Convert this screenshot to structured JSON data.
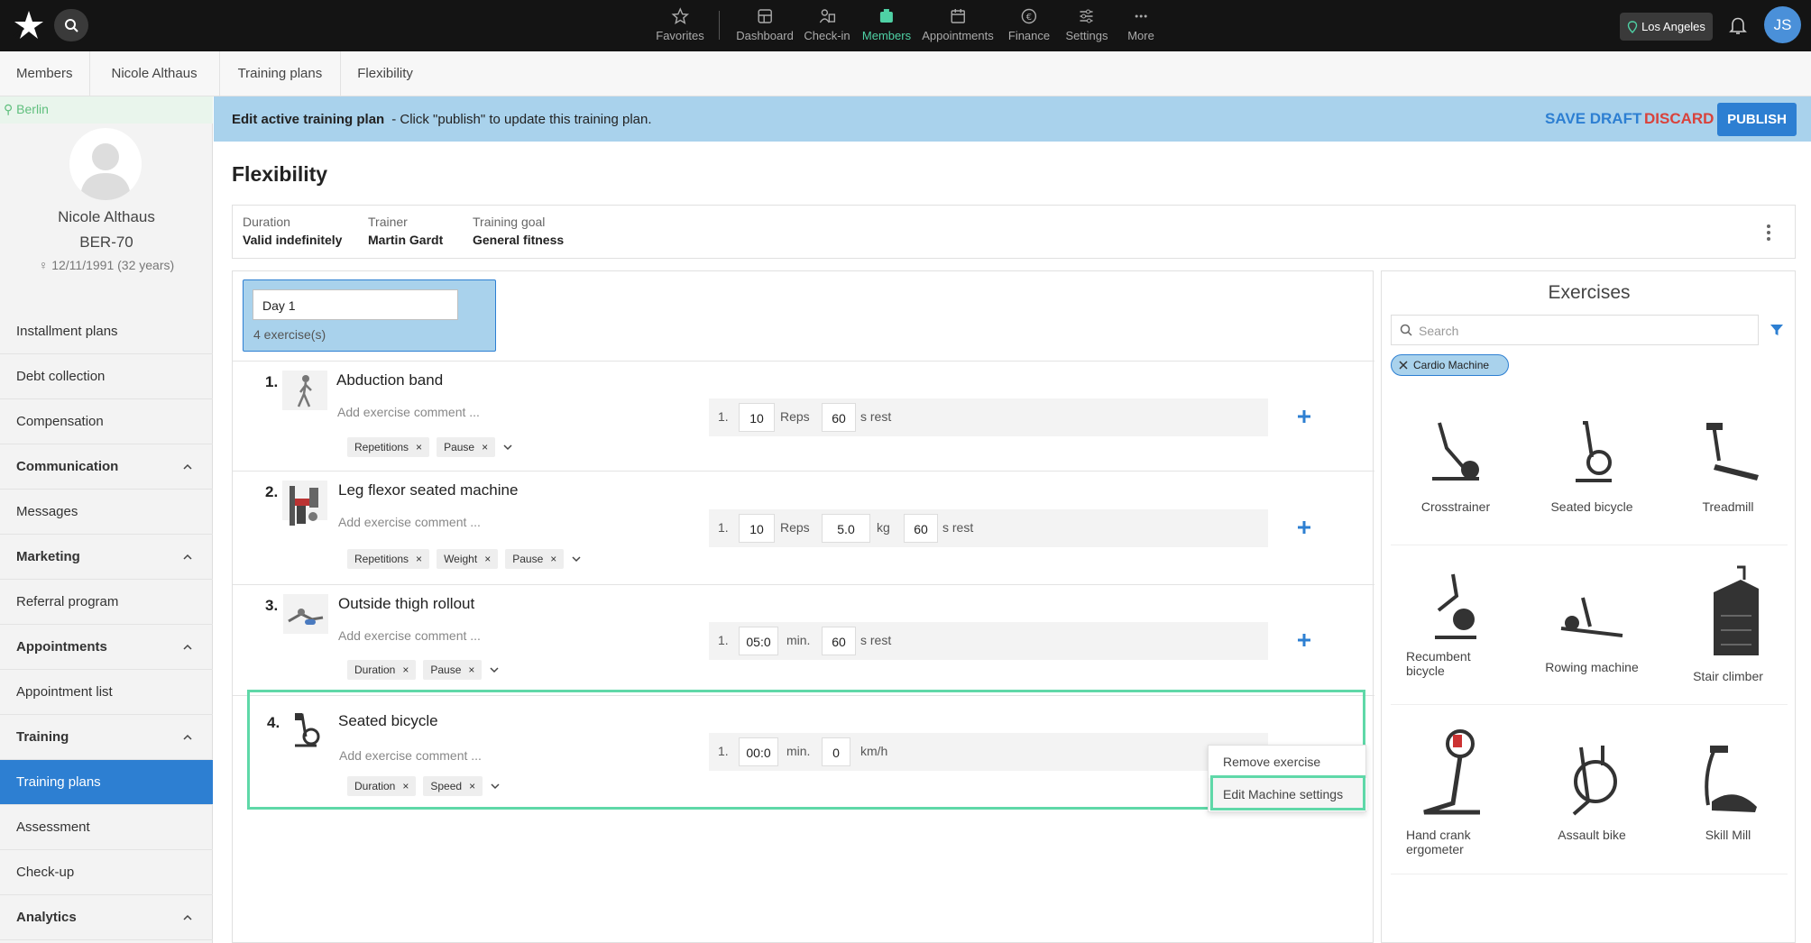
{
  "nav": {
    "items": [
      {
        "label": "Favorites",
        "icon": "star-icon"
      },
      {
        "label": "Dashboard",
        "icon": "dashboard-icon"
      },
      {
        "label": "Check-in",
        "icon": "check-in-icon"
      },
      {
        "label": "Members",
        "icon": "members-icon",
        "active": true
      },
      {
        "label": "Appointments",
        "icon": "calendar-icon"
      },
      {
        "label": "Finance",
        "icon": "euro-icon"
      },
      {
        "label": "Settings",
        "icon": "sliders-icon"
      },
      {
        "label": "More",
        "icon": "more-icon"
      }
    ],
    "location": "Los Angeles",
    "user_initials": "JS",
    "accent": "#4fd1a5"
  },
  "breadcrumb": [
    "Members",
    "Nicole Althaus",
    "Training plans",
    "Flexibility"
  ],
  "member": {
    "location": "Berlin",
    "name": "Nicole Althaus",
    "id": "BER-70",
    "dob": "12/11/1991 (32 years)"
  },
  "sidebar": {
    "items": [
      {
        "label": "Installment plans"
      },
      {
        "label": "Debt collection"
      },
      {
        "label": "Compensation"
      },
      {
        "label": "Communication",
        "header": true
      },
      {
        "label": "Messages"
      },
      {
        "label": "Marketing",
        "header": true
      },
      {
        "label": "Referral program"
      },
      {
        "label": "Appointments",
        "header": true
      },
      {
        "label": "Appointment list"
      },
      {
        "label": "Training",
        "header": true
      },
      {
        "label": "Training plans",
        "active": true
      },
      {
        "label": "Assessment"
      },
      {
        "label": "Check-up"
      },
      {
        "label": "Analytics",
        "header": true
      }
    ]
  },
  "banner": {
    "title": "Edit active training plan",
    "message": "-  Click \"publish\" to update this training plan.",
    "save_draft": "SAVE DRAFT",
    "discard": "DISCARD",
    "publish": "PUBLISH"
  },
  "plan": {
    "title": "Flexibility",
    "duration_label": "Duration",
    "duration": "Valid indefinitely",
    "trainer_label": "Trainer",
    "trainer": "Martin Gardt",
    "goal_label": "Training goal",
    "goal": "General fitness"
  },
  "day": {
    "name": "Day 1",
    "count": "4 exercise(s)"
  },
  "exercises": [
    {
      "num": "1.",
      "name": "Abduction band",
      "comment": "Add exercise comment ...",
      "chips": [
        "Repetitions",
        "Pause"
      ],
      "set": "1.",
      "v1": "10",
      "u1": "Reps",
      "v2": "60",
      "u2": "s rest"
    },
    {
      "num": "2.",
      "name": "Leg flexor seated machine",
      "comment": "Add exercise comment ...",
      "chips": [
        "Repetitions",
        "Weight",
        "Pause"
      ],
      "set": "1.",
      "v1": "10",
      "u1": "Reps",
      "v2": "5.0",
      "u2": "kg",
      "v3": "60",
      "u3": "s rest"
    },
    {
      "num": "3.",
      "name": "Outside thigh rollout",
      "comment": "Add exercise comment ...",
      "chips": [
        "Duration",
        "Pause"
      ],
      "set": "1.",
      "v1": "05:0",
      "u1": "min.",
      "v2": "60",
      "u2": "s rest"
    },
    {
      "num": "4.",
      "name": "Seated bicycle",
      "comment": "Add exercise comment ...",
      "chips": [
        "Duration",
        "Speed"
      ],
      "set": "1.",
      "v1": "00:0",
      "u1": "min.",
      "v2": "0",
      "u2": "km/h"
    }
  ],
  "context_menu": {
    "remove": "Remove exercise",
    "edit": "Edit Machine settings"
  },
  "library": {
    "title": "Exercises",
    "search_placeholder": "Search",
    "filter": "Cardio Machine",
    "items": [
      "Crosstrainer",
      "Seated bicycle",
      "Treadmill",
      "Recumbent bicycle",
      "Rowing machine",
      "Stair climber",
      "Hand crank ergometer",
      "Assault bike",
      "Skill Mill"
    ]
  }
}
